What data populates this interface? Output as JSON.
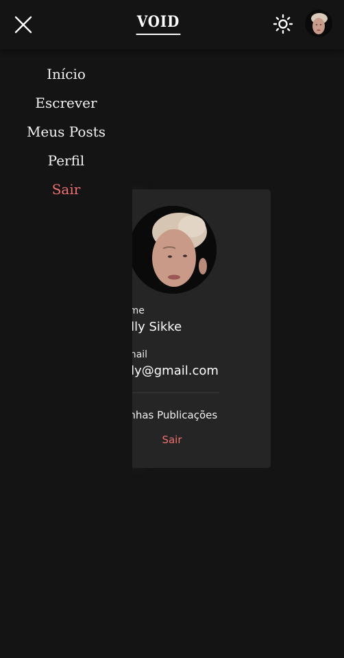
{
  "header": {
    "logo": "VOID",
    "close_icon": "close-icon",
    "theme_icon": "sun-icon",
    "avatar_icon": "user-avatar"
  },
  "menu": {
    "items": [
      {
        "label": "Início"
      },
      {
        "label": "Escrever"
      },
      {
        "label": "Meus Posts"
      },
      {
        "label": "Perfil"
      },
      {
        "label": "Sair"
      }
    ]
  },
  "profile": {
    "name_label": "ome",
    "name_value": "elly Sikke",
    "email_label": "-mail",
    "email_value": "ely@gmail.com",
    "publications_link": "linhas Publicações",
    "logout_label": "Sair"
  },
  "colors": {
    "background": "#141414",
    "card": "#252525",
    "accent_logout": "#f07070",
    "text": "#ffffff"
  }
}
